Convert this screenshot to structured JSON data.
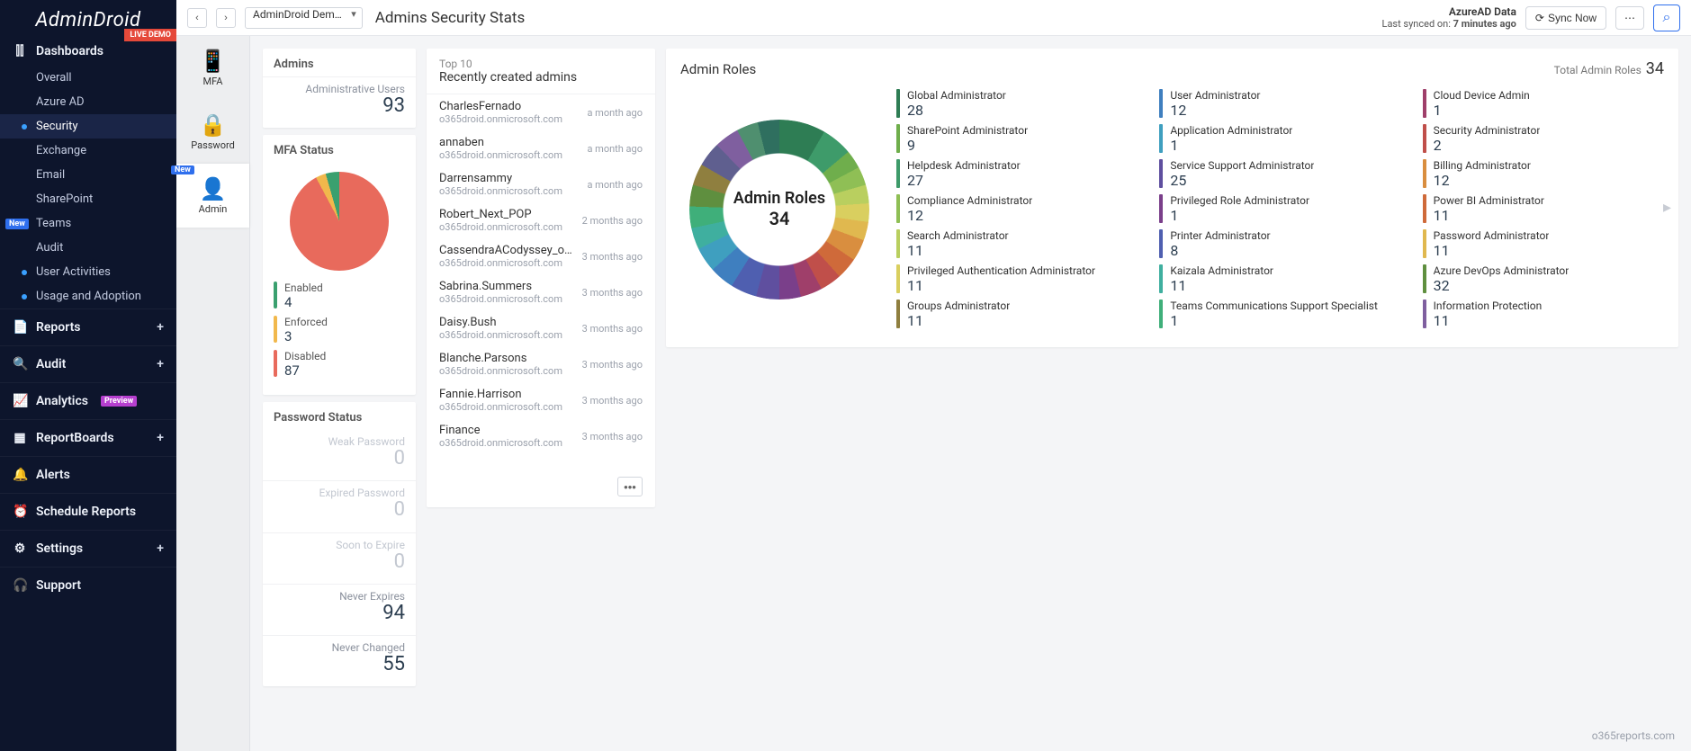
{
  "brand": "AdminDroid",
  "live_demo_badge": "LIVE DEMO",
  "topbar": {
    "back": "‹",
    "fwd": "›",
    "tenant": "AdminDroid Dem…",
    "title": "Admins Security Stats",
    "sync_source": "AzureAD Data",
    "sync_prefix": "Last synced on: ",
    "sync_time": "7 minutes ago",
    "sync_now": "Sync Now",
    "more": "⋯",
    "search": "⌕"
  },
  "sidebar": {
    "dashboards": {
      "label": "Dashboards",
      "items": [
        {
          "label": "Overall"
        },
        {
          "label": "Azure AD"
        },
        {
          "label": "Security",
          "active": true
        },
        {
          "label": "Exchange"
        },
        {
          "label": "Email"
        },
        {
          "label": "SharePoint"
        },
        {
          "label": "Teams",
          "new": true
        },
        {
          "label": "Audit"
        },
        {
          "label": "User Activities",
          "dot": true
        },
        {
          "label": "Usage and Adoption",
          "dot": true
        }
      ]
    },
    "sections": [
      {
        "icon": "📄",
        "label": "Reports",
        "plus": true
      },
      {
        "icon": "🔍",
        "label": "Audit",
        "plus": true
      },
      {
        "icon": "📈",
        "label": "Analytics",
        "preview": "Preview"
      },
      {
        "icon": "▦",
        "label": "ReportBoards",
        "plus": true
      },
      {
        "icon": "🔔",
        "label": "Alerts"
      },
      {
        "icon": "⏰",
        "label": "Schedule Reports"
      },
      {
        "icon": "⚙",
        "label": "Settings",
        "plus": true
      },
      {
        "icon": "🎧",
        "label": "Support"
      }
    ]
  },
  "rail": [
    {
      "icon": "📱",
      "label": "MFA"
    },
    {
      "icon": "🔒",
      "label": "Password"
    },
    {
      "icon": "👤",
      "label": "Admin",
      "active": true,
      "badge": "New"
    }
  ],
  "admins_card": {
    "title": "Admins",
    "stat_label": "Administrative Users",
    "stat_value": "93"
  },
  "mfa_card": {
    "title": "MFA Status",
    "items": [
      {
        "label": "Enabled",
        "value": "4",
        "color": "#3aa06f"
      },
      {
        "label": "Enforced",
        "value": "3",
        "color": "#f1b84c"
      },
      {
        "label": "Disabled",
        "value": "87",
        "color": "#e86a5c"
      }
    ]
  },
  "pwd_card": {
    "title": "Password Status",
    "items": [
      {
        "label": "Weak Password",
        "value": "0",
        "muted": true
      },
      {
        "label": "Expired Password",
        "value": "0",
        "muted": true
      },
      {
        "label": "Soon to Expire",
        "value": "0",
        "muted": true
      },
      {
        "label": "Never Expires",
        "value": "94"
      },
      {
        "label": "Never Changed",
        "value": "55"
      }
    ]
  },
  "recent_card": {
    "top": "Top 10",
    "title": "Recently created admins",
    "domain": "o365droid.onmicrosoft.com",
    "items": [
      {
        "name": "CharlesFernado",
        "ago": "a month ago"
      },
      {
        "name": "annaben",
        "ago": "a month ago"
      },
      {
        "name": "Darrensammy",
        "ago": "a month ago"
      },
      {
        "name": "Robert_Next_POP",
        "ago": "2 months ago"
      },
      {
        "name": "CassendraACodyssey_out…",
        "ago": "3 months ago"
      },
      {
        "name": "Sabrina.Summers",
        "ago": "3 months ago"
      },
      {
        "name": "Daisy.Bush",
        "ago": "3 months ago"
      },
      {
        "name": "Blanche.Parsons",
        "ago": "3 months ago"
      },
      {
        "name": "Fannie.Harrison",
        "ago": "3 months ago"
      },
      {
        "name": "Finance",
        "ago": "3 months ago"
      }
    ],
    "more": "•••"
  },
  "roles_card": {
    "title": "Admin Roles",
    "total_label": "Total Admin Roles",
    "total_value": "34",
    "donut_title": "Admin Roles",
    "donut_value": "34",
    "items": [
      {
        "role": "Global Administrator",
        "count": "28",
        "color": "#2e7d54"
      },
      {
        "role": "User Administrator",
        "count": "12",
        "color": "#3f7fbf"
      },
      {
        "role": "Cloud Device Admin",
        "count": "1",
        "color": "#9f3f6a"
      },
      {
        "role": "SharePoint Administrator",
        "count": "9",
        "color": "#6fae4c"
      },
      {
        "role": "Application Administrator",
        "count": "1",
        "color": "#3f9fbf"
      },
      {
        "role": "Security Administrator",
        "count": "2",
        "color": "#c04f4a"
      },
      {
        "role": "Helpdesk Administrator",
        "count": "27",
        "color": "#3e9b6a"
      },
      {
        "role": "Service Support Administrator",
        "count": "25",
        "color": "#5f4f9f"
      },
      {
        "role": "Billing Administrator",
        "count": "12",
        "color": "#d98e3f"
      },
      {
        "role": "Compliance Administrator",
        "count": "12",
        "color": "#8fbf55"
      },
      {
        "role": "Privileged Role Administrator",
        "count": "1",
        "color": "#7a3f8a"
      },
      {
        "role": "Power BI Administrator",
        "count": "11",
        "color": "#cf6a3a"
      },
      {
        "role": "Search Administrator",
        "count": "11",
        "color": "#b9cf5f"
      },
      {
        "role": "Printer Administrator",
        "count": "8",
        "color": "#4f5fb0"
      },
      {
        "role": "Password Administrator",
        "count": "11",
        "color": "#e0b84f"
      },
      {
        "role": "Privileged Authentication Administrator",
        "count": "11",
        "color": "#d9cf5f"
      },
      {
        "role": "Kaizala Administrator",
        "count": "11",
        "color": "#3faf9f"
      },
      {
        "role": "Azure DevOps Administrator",
        "count": "32",
        "color": "#5f8f3f"
      },
      {
        "role": "Groups Administrator",
        "count": "11",
        "color": "#8f7f3f"
      },
      {
        "role": "Teams Communications Support Specialist",
        "count": "1",
        "color": "#3faf7a"
      },
      {
        "role": "Information Protection",
        "count": "11",
        "color": "#7f5f9f"
      }
    ],
    "nav": "▸"
  },
  "chart_data": [
    {
      "type": "pie",
      "title": "MFA Status",
      "categories": [
        "Disabled",
        "Enforced",
        "Enabled"
      ],
      "values": [
        87,
        3,
        4
      ]
    },
    {
      "type": "pie",
      "title": "Admin Roles",
      "categories": [
        "Global Administrator",
        "User Administrator",
        "Cloud Device Admin",
        "SharePoint Administrator",
        "Application Administrator",
        "Security Administrator",
        "Helpdesk Administrator",
        "Service Support Administrator",
        "Billing Administrator",
        "Compliance Administrator",
        "Privileged Role Administrator",
        "Power BI Administrator",
        "Search Administrator",
        "Printer Administrator",
        "Password Administrator",
        "Privileged Authentication Administrator",
        "Kaizala Administrator",
        "Azure DevOps Administrator",
        "Groups Administrator",
        "Teams Communications Support Specialist",
        "Information Protection"
      ],
      "values": [
        28,
        12,
        1,
        9,
        1,
        2,
        27,
        25,
        12,
        12,
        1,
        11,
        11,
        8,
        11,
        11,
        11,
        32,
        11,
        1,
        11
      ],
      "annotation": "Total Admin Roles 34"
    }
  ],
  "watermark": "o365reports.com"
}
